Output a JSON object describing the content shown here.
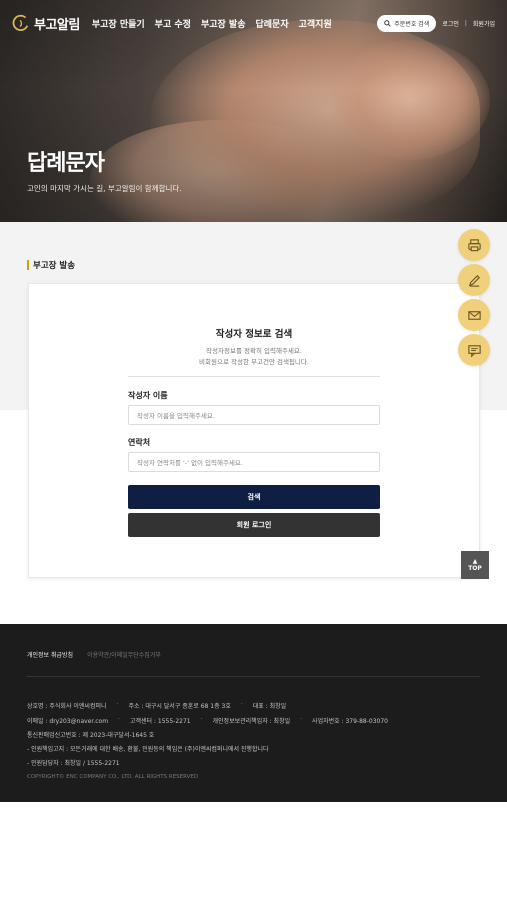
{
  "header": {
    "logo_text": "부고알림",
    "nav": [
      "부고장 만들기",
      "부고 수정",
      "부고장 발송",
      "답례문자",
      "고객지원"
    ],
    "order_search_label": "주문번호 검색",
    "login": "로그인",
    "separator": "|",
    "signup": "회원가입"
  },
  "hero": {
    "title": "답례문자",
    "subtitle": "고인의 마지막 가시는 길, 부고알림이 함께합니다."
  },
  "section": {
    "label": "부고장 발송"
  },
  "form": {
    "title": "작성자 정보로 검색",
    "desc1": "작성자정보를 정확히 입력해주세요.",
    "desc2": "비회원으로 작성한 부고건만 검색됩니다.",
    "name_label": "작성자 이름",
    "name_placeholder": "작성자 이름을 입력해주세요.",
    "phone_label": "연락처",
    "phone_placeholder": "작성자 연락처를 '-' 없이 입력해주세요.",
    "search_button": "검색",
    "login_button": "회원 로그인"
  },
  "quick_menu": {
    "icons": [
      "print-icon",
      "pen-icon",
      "envelope-icon",
      "message-icon"
    ],
    "accent_color": "#f0d07a"
  },
  "top_button": {
    "arrow": "▲",
    "label": "TOP"
  },
  "footer": {
    "link_privacy": "개인정보 취급방침",
    "link_terms": "이용약관/이메일무단수집거부",
    "company_label": "상호명 : 주식회사 이엔씨컴퍼니",
    "address": "주소 : 대구시 달서구 종훈로 68 1층 3호",
    "ceo": "대표 : 최창일",
    "email": "이메일 : dry203@naver.com",
    "service_center": "고객센터 : 1555-2271",
    "privacy_officer": "개인정보보관리책임자 : 최창일",
    "business_no": "사업자번호 : 379-88-03070",
    "mail_order_no": "통신판매업신고번호 : 제 2023-대구달서-1645 호",
    "notice": "- 인원책임고지 : 모든거래에 대한 배송, 환불, 민원등의 책임은 (주)이엔씨컴퍼니에서 진행합니다",
    "contact": "- 민원담당자 : 최창일 / 1555-2271",
    "copyright": "COPYRIGHT© ENC COMPANY CO., LTD. ALL RIGHTS RESERVED"
  }
}
